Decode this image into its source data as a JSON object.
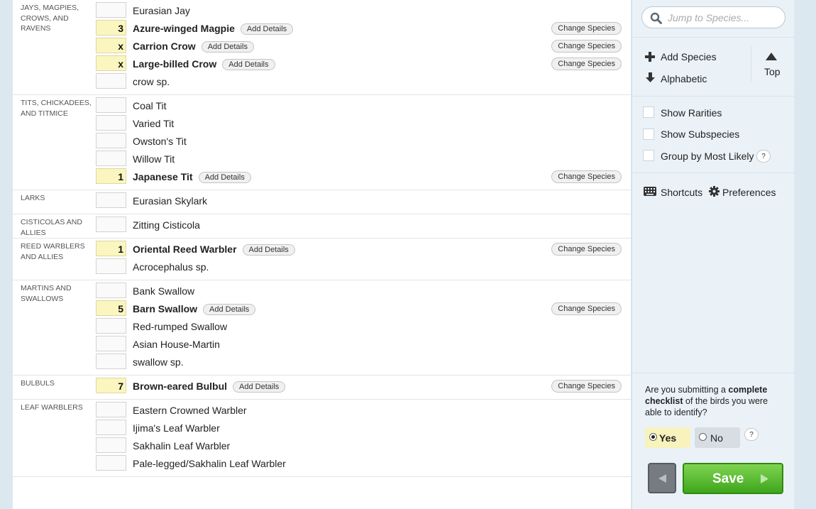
{
  "groups": [
    {
      "name": "JAYS, MAGPIES, CROWS, AND RAVENS",
      "rows": [
        {
          "count": "",
          "species": "Eurasian Jay",
          "bold": false
        },
        {
          "count": "3",
          "species": "Azure-winged Magpie",
          "bold": true
        },
        {
          "count": "x",
          "species": "Carrion Crow",
          "bold": true
        },
        {
          "count": "x",
          "species": "Large-billed Crow",
          "bold": true
        },
        {
          "count": "",
          "species": "crow sp.",
          "bold": false
        }
      ]
    },
    {
      "name": "TITS, CHICKADEES, AND TITMICE",
      "rows": [
        {
          "count": "",
          "species": "Coal Tit",
          "bold": false
        },
        {
          "count": "",
          "species": "Varied Tit",
          "bold": false
        },
        {
          "count": "",
          "species": "Owston's Tit",
          "bold": false
        },
        {
          "count": "",
          "species": "Willow Tit",
          "bold": false
        },
        {
          "count": "1",
          "species": "Japanese Tit",
          "bold": true
        }
      ]
    },
    {
      "name": "LARKS",
      "rows": [
        {
          "count": "",
          "species": "Eurasian Skylark",
          "bold": false
        }
      ]
    },
    {
      "name": "CISTICOLAS AND ALLIES",
      "rows": [
        {
          "count": "",
          "species": "Zitting Cisticola",
          "bold": false
        }
      ]
    },
    {
      "name": "REED WARBLERS AND ALLIES",
      "rows": [
        {
          "count": "1",
          "species": "Oriental Reed Warbler",
          "bold": true
        },
        {
          "count": "",
          "species": "Acrocephalus sp.",
          "bold": false
        }
      ]
    },
    {
      "name": "MARTINS AND SWALLOWS",
      "rows": [
        {
          "count": "",
          "species": "Bank Swallow",
          "bold": false
        },
        {
          "count": "5",
          "species": "Barn Swallow",
          "bold": true
        },
        {
          "count": "",
          "species": "Red-rumped Swallow",
          "bold": false
        },
        {
          "count": "",
          "species": "Asian House-Martin",
          "bold": false
        },
        {
          "count": "",
          "species": "swallow sp.",
          "bold": false
        }
      ]
    },
    {
      "name": "BULBULS",
      "rows": [
        {
          "count": "7",
          "species": "Brown-eared Bulbul",
          "bold": true
        }
      ]
    },
    {
      "name": "LEAF WARBLERS",
      "rows": [
        {
          "count": "",
          "species": "Eastern Crowned Warbler",
          "bold": false
        },
        {
          "count": "",
          "species": "Ijima's Leaf Warbler",
          "bold": false
        },
        {
          "count": "",
          "species": "Sakhalin Leaf Warbler",
          "bold": false
        },
        {
          "count": "",
          "species": "Pale-legged/Sakhalin Leaf Warbler",
          "bold": false
        }
      ]
    }
  ],
  "labels": {
    "add_details": "Add Details",
    "change_species": "Change Species"
  },
  "sidebar": {
    "search_placeholder": "Jump to Species...",
    "add_species": "Add Species",
    "alphabetic": "Alphabetic",
    "top": "Top",
    "show_rarities": "Show Rarities",
    "show_subspecies": "Show Subspecies",
    "group_by_most_likely": "Group by Most Likely",
    "help": "?",
    "shortcuts": "Shortcuts",
    "preferences": "Preferences",
    "question_pre": "Are you submitting a ",
    "question_bold": "complete checklist",
    "question_post": " of the birds you were able to identify?",
    "yes": "Yes",
    "no": "No",
    "save": "Save"
  },
  "colors": {
    "accent_green": "#4fb52a",
    "filled_count": "#fbf6c0"
  }
}
